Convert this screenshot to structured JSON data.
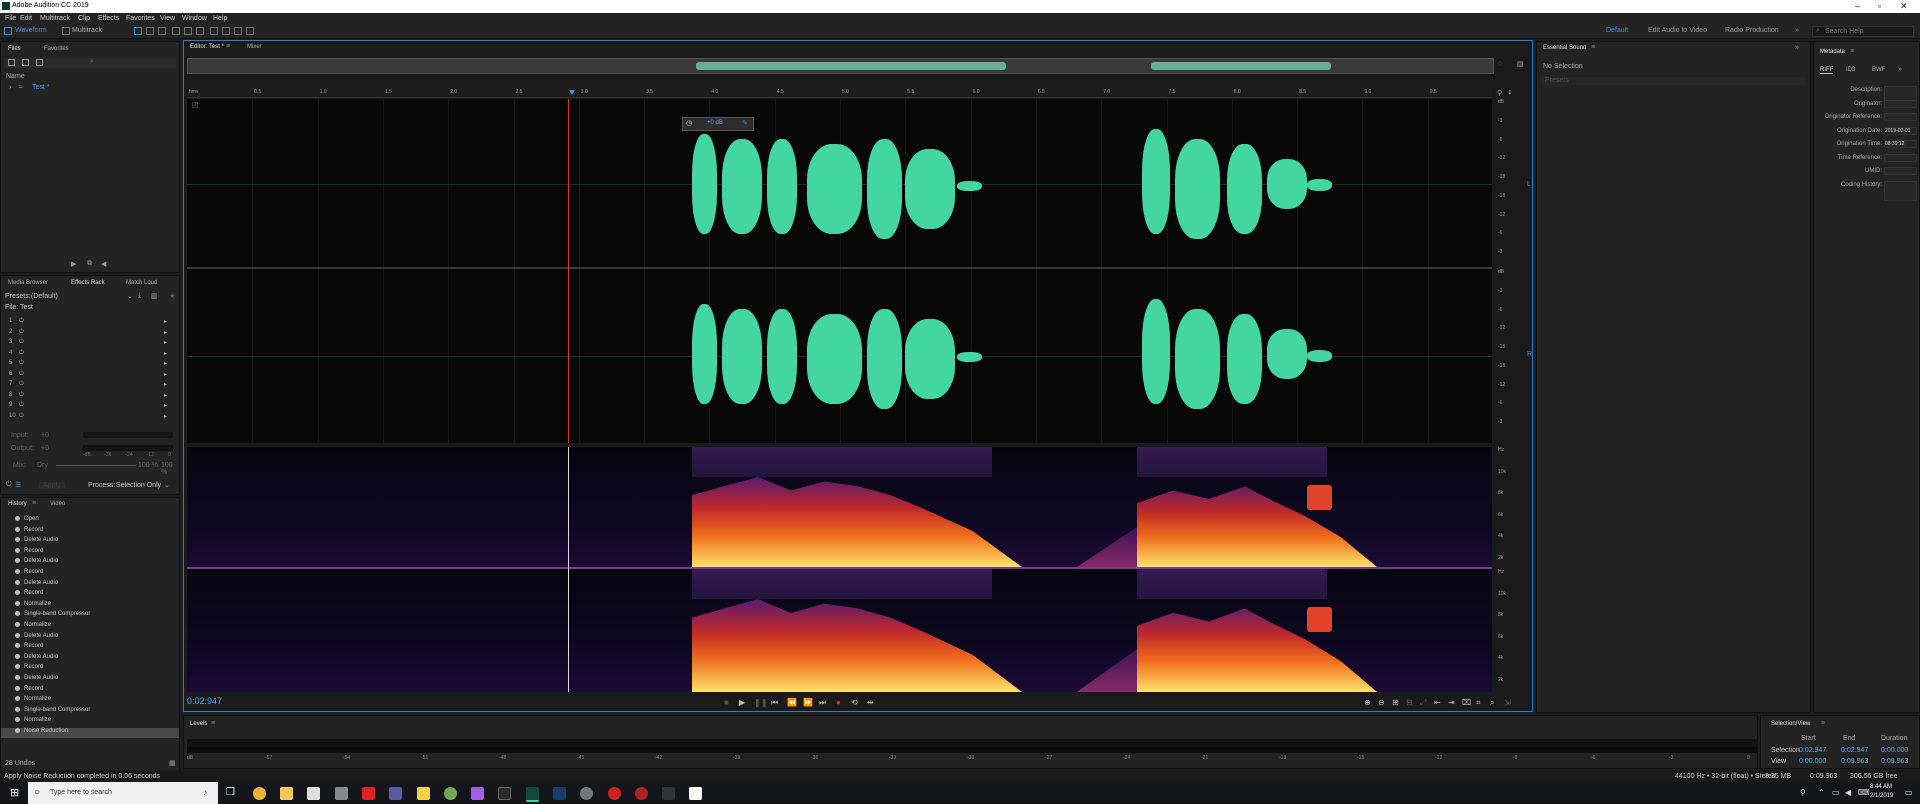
{
  "window": {
    "title": "Adobe Audition CC 2019"
  },
  "menu": [
    "File",
    "Edit",
    "Multitrack",
    "Clip",
    "Effects",
    "Favorites",
    "View",
    "Window",
    "Help"
  ],
  "toolbar": {
    "waveform": "Waveform",
    "multitrack": "Multitrack",
    "workspace_default": "Default",
    "workspace_add_audio": "Edit Audio to Video",
    "workspace_radio": "Radio Production",
    "search_placeholder": "Search Help"
  },
  "files_panel": {
    "tab_files": "Files",
    "tab_favorites": "Favorites",
    "col_name": "Name",
    "file_name": "Test *"
  },
  "effects_panel": {
    "tab_media": "Media Browser",
    "tab_rack": "Effects Rack",
    "tab_match": "Match Loud",
    "presets_label": "Presets:",
    "presets_value": "(Default)",
    "file_label": "File: Test",
    "slots": [
      "1",
      "2",
      "3",
      "4",
      "5",
      "6",
      "7",
      "8",
      "9",
      "10"
    ],
    "input_label": "Input:",
    "input_value": "+0",
    "output_label": "Output:",
    "output_value": "+0",
    "mix_label": "Mix:",
    "mix_dry": "Dry",
    "mix_wet": "100 %",
    "mix_pct": "100 %",
    "meter_ticks": [
      "-dB",
      "-36",
      "-24",
      "-12",
      "0"
    ],
    "apply_label": "Apply",
    "process_label": "Process:",
    "process_value": "Selection Only"
  },
  "history_panel": {
    "tab_history": "History",
    "tab_video": "Video",
    "items": [
      "Open",
      "Record",
      "Delete Audio",
      "Record",
      "Delete Audio",
      "Record",
      "Delete Audio",
      "Record",
      "Normalize",
      "Single-band Compressor",
      "Normalize",
      "Delete Audio",
      "Record",
      "Delete Audio",
      "Record",
      "Delete Audio",
      "Record",
      "Normalize",
      "Single-band Compressor",
      "Normalize",
      "Noise Reduction"
    ],
    "undo_count": "28 Undos"
  },
  "editor": {
    "tab_editor": "Editor: Test *",
    "tab_mixer": "Mixer",
    "time_current": "0:02.947",
    "hud_value": "+0 dB",
    "ruler_ticks": [
      "hms",
      "0.5",
      "1.0",
      "1.5",
      "2.0",
      "2.5",
      "3.0",
      "3.5",
      "4.0",
      "4.5",
      "5.0",
      "5.5",
      "6.0",
      "6.5",
      "7.0",
      "7.5",
      "8.0",
      "8.5",
      "9.0",
      "9.5"
    ],
    "db_scale_top": [
      "dB",
      "-3",
      "-6",
      "-12",
      "-18",
      "-18",
      "-12",
      "-6",
      "-3"
    ],
    "db_scale_bottom": [
      "dB",
      "-3",
      "-6",
      "-12",
      "-18",
      "-18",
      "-12",
      "-6",
      "-3"
    ],
    "hz_scale_top": [
      "Hz",
      "10k",
      "8k",
      "6k",
      "4k",
      "2k"
    ],
    "hz_scale_bottom": [
      "Hz",
      "10k",
      "8k",
      "6k",
      "4k",
      "2k"
    ]
  },
  "essential_sound": {
    "title": "Essential Sound",
    "no_selection": "No Selection",
    "presets": "Presets"
  },
  "metadata": {
    "title": "Metadata",
    "tab_riff": "RIFF",
    "tab_id3": "ID3",
    "tab_bwf": "BWF",
    "fields": [
      "Description:",
      "Originator:",
      "Originator Reference:",
      "Origination Date:",
      "Origination Time:",
      "Time Reference:",
      "UMID:",
      "Coding History:"
    ],
    "origination_date": "2019-02-01",
    "origination_time": "08:39:12"
  },
  "levels": {
    "title": "Levels",
    "ticks": [
      "dB",
      "-57",
      "-54",
      "-51",
      "-48",
      "-45",
      "-42",
      "-39",
      "-36",
      "-33",
      "-30",
      "-27",
      "-24",
      "-21",
      "-18",
      "-15",
      "-12",
      "-9",
      "-6",
      "-3",
      "0"
    ]
  },
  "selection_view": {
    "title": "Selection/View",
    "col_start": "Start",
    "col_end": "End",
    "col_duration": "Duration",
    "row_selection": "Selection",
    "row_view": "View",
    "sel_start": "0:02.947",
    "sel_end": "0:02.947",
    "sel_duration": "0:00.000",
    "view_start": "0:00.000",
    "view_end": "0:09.963",
    "view_duration": "0:09.963"
  },
  "status": {
    "message": "Apply Noise Reduction completed in 0.06 seconds",
    "format": "44100 Hz • 32-bit (float) • Stereo",
    "size": "3.35 MB",
    "duration": "0:09.963",
    "free": "306.56 GB free"
  },
  "taskbar": {
    "search_placeholder": "Type here to search",
    "time": "8:44 AM",
    "date": "2/1/2019"
  },
  "colors": {
    "accent": "#2d7bd6",
    "waveform": "#43d6a0"
  }
}
